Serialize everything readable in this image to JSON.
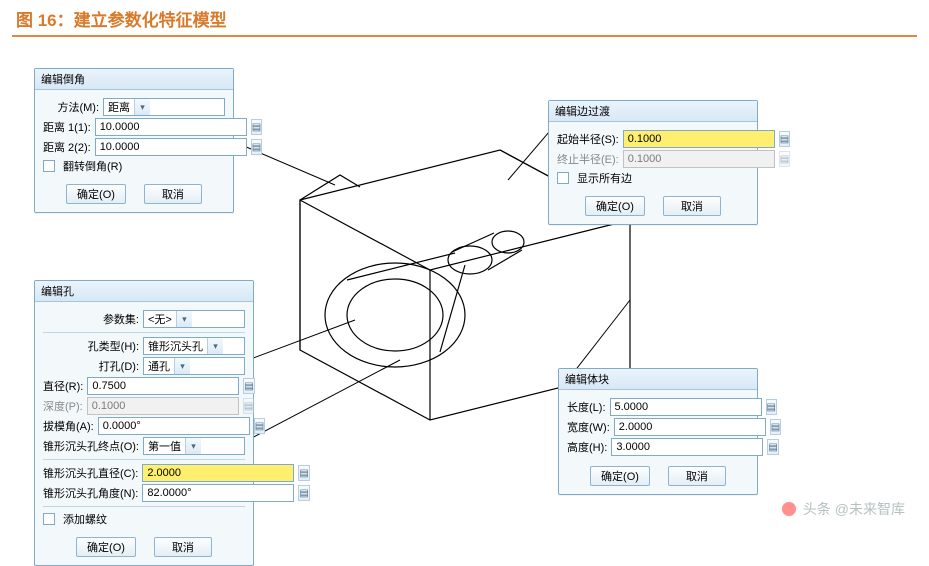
{
  "figure": {
    "title": "图 16：建立参数化特征模型"
  },
  "watermark": {
    "text": "头条 @未来智库"
  },
  "panel_chamfer": {
    "title": "编辑倒角",
    "method_label": "方法(M):",
    "method_value": "距离",
    "dist1_label": "距离 1(1):",
    "dist1_value": "10.0000",
    "dist2_label": "距离 2(2):",
    "dist2_value": "10.0000",
    "flip_label": "翻转倒角(R)",
    "ok": "确定(O)",
    "cancel": "取消"
  },
  "panel_blend": {
    "title": "编辑边过渡",
    "start_label": "起始半径(S):",
    "start_value": "0.1000",
    "end_label": "终止半径(E):",
    "end_value": "0.1000",
    "showall_label": "显示所有边",
    "ok": "确定(O)",
    "cancel": "取消"
  },
  "panel_hole": {
    "title": "编辑孔",
    "paramset_label": "参数集:",
    "paramset_value": "<无>",
    "type_label": "孔类型(H):",
    "type_value": "锥形沉头孔",
    "drill_label": "打孔(D):",
    "drill_value": "通孔",
    "dia_label": "直径(R):",
    "dia_value": "0.7500",
    "depth_label": "深度(P):",
    "depth_value": "0.1000",
    "tipang_label": "拔模角(A):",
    "tipang_value": "0.0000°",
    "endpt_label": "锥形沉头孔终点(O):",
    "endpt_value": "第一值",
    "cdia_label": "锥形沉头孔直径(C):",
    "cdia_value": "2.0000",
    "cang_label": "锥形沉头孔角度(N):",
    "cang_value": "82.0000°",
    "thread_label": "添加螺纹",
    "ok": "确定(O)",
    "cancel": "取消"
  },
  "panel_block": {
    "title": "编辑体块",
    "len_label": "长度(L):",
    "len_value": "5.0000",
    "wid_label": "宽度(W):",
    "wid_value": "2.0000",
    "hei_label": "高度(H):",
    "hei_value": "3.0000",
    "ok": "确定(O)",
    "cancel": "取消"
  },
  "icons": {
    "caret": "▾",
    "tool": "▤"
  }
}
